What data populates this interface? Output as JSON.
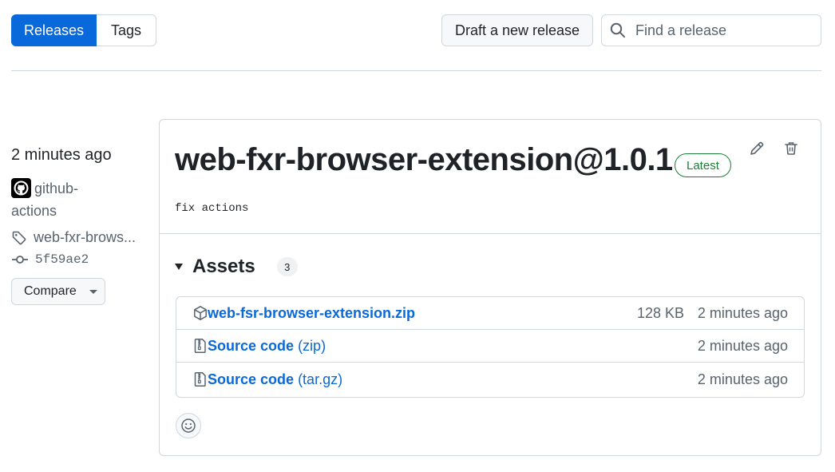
{
  "subnav": {
    "releases_label": "Releases",
    "tags_label": "Tags"
  },
  "toolbar": {
    "draft_label": "Draft a new release",
    "search_placeholder": "Find a release"
  },
  "sidebar": {
    "time": "2 minutes ago",
    "author": "github-actions",
    "tag": "web-fxr-brows...",
    "commit": "5f59ae2",
    "compare_label": "Compare"
  },
  "release": {
    "title": "web-fxr-browser-extension@1.0.1",
    "badge": "Latest",
    "body": "fix actions"
  },
  "assets": {
    "heading": "Assets",
    "count": "3",
    "items": [
      {
        "name": "web-fsr-browser-extension.zip",
        "size": "128 KB",
        "time": "2 minutes ago"
      },
      {
        "name": "Source code",
        "ext": "(zip)",
        "time": "2 minutes ago"
      },
      {
        "name": "Source code",
        "ext": "(tar.gz)",
        "time": "2 minutes ago"
      }
    ]
  },
  "colors": {
    "accent": "#0969da",
    "success": "#1a7f37",
    "border": "#d0d7de",
    "muted": "#59636e"
  }
}
